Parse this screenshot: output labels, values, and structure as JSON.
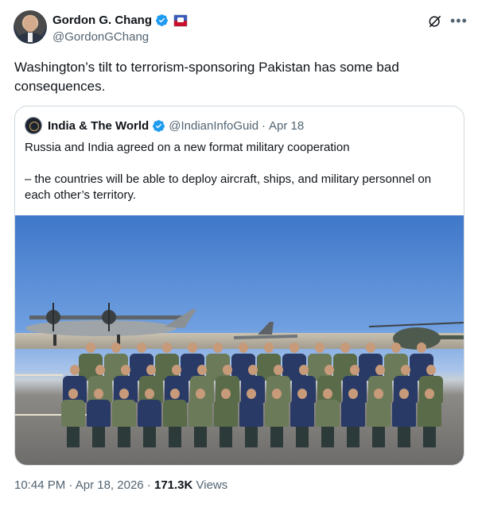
{
  "author": {
    "display_name": "Gordon G. Chang",
    "handle": "@GordonGChang"
  },
  "tweet": {
    "text": "Washington’s tilt to terrorism-sponsoring Pakistan has some bad consequences."
  },
  "quoted": {
    "display_name": "India & The World",
    "handle": "@IndianInfoGuid",
    "separator": "·",
    "date": "Apr 18",
    "line1": "Russia and India agreed on a new format military cooperation",
    "line2": "–  the countries will be able to deploy aircraft, ships, and military personnel on each other’s territory."
  },
  "meta": {
    "time": "10:44 PM",
    "dot1": " · ",
    "date": "Apr 18, 2026",
    "dot2": " · ",
    "views_count": "171.3K",
    "views_label": " Views"
  },
  "icons": {
    "verified": "verified-badge-icon",
    "grok": "grok-icon",
    "more": "more-icon"
  },
  "colors": {
    "verified_blue": "#1d9bf0",
    "secondary_text": "#536471",
    "border": "#cfd9de"
  }
}
